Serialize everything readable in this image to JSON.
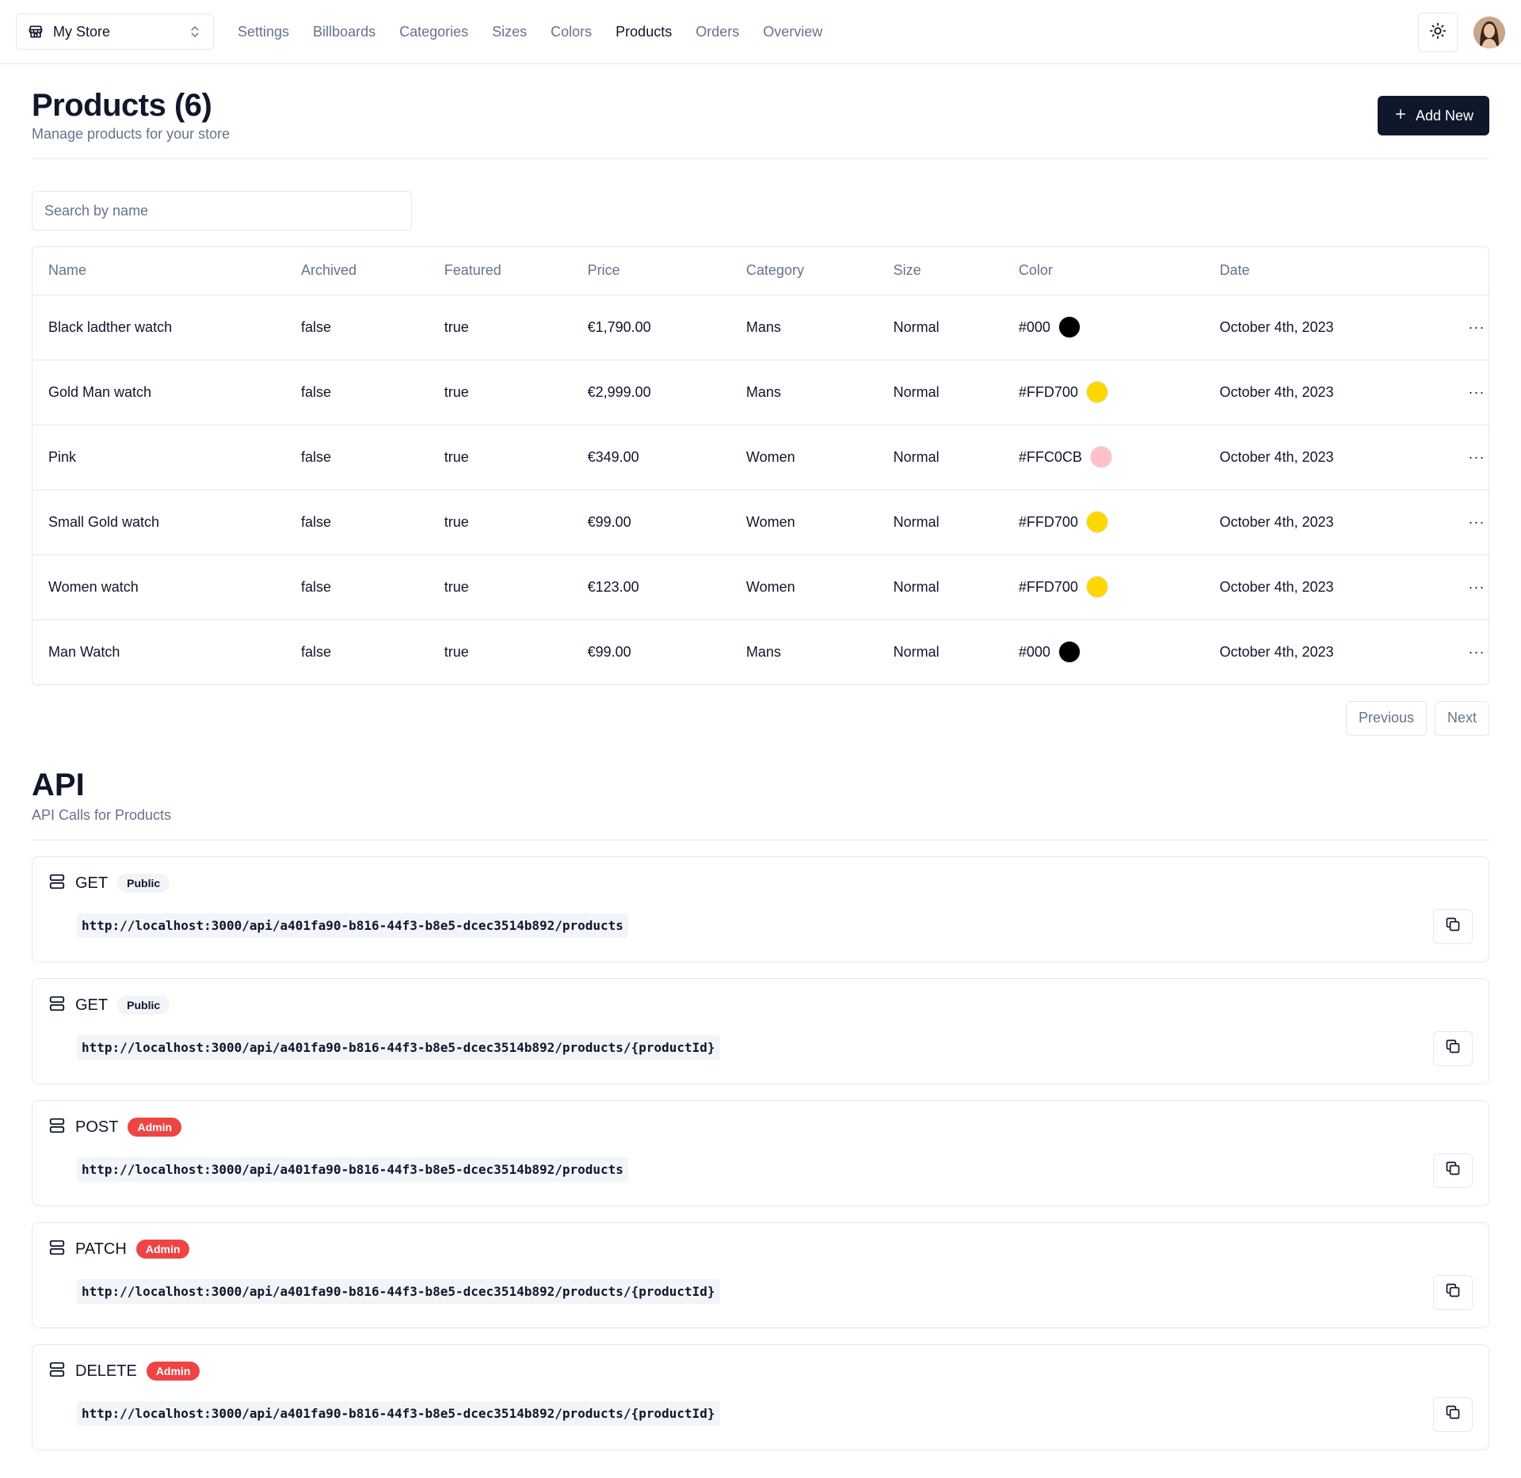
{
  "store": {
    "name": "My Store"
  },
  "nav": [
    {
      "label": "Settings",
      "active": false
    },
    {
      "label": "Billboards",
      "active": false
    },
    {
      "label": "Categories",
      "active": false
    },
    {
      "label": "Sizes",
      "active": false
    },
    {
      "label": "Colors",
      "active": false
    },
    {
      "label": "Products",
      "active": true
    },
    {
      "label": "Orders",
      "active": false
    },
    {
      "label": "Overview",
      "active": false
    }
  ],
  "header": {
    "title": "Products (6)",
    "subtitle": "Manage products for your store",
    "add_label": "Add New"
  },
  "search": {
    "placeholder": "Search by name"
  },
  "table": {
    "columns": [
      "Name",
      "Archived",
      "Featured",
      "Price",
      "Category",
      "Size",
      "Color",
      "Date"
    ],
    "rows": [
      {
        "name": "Black ladther watch",
        "archived": "false",
        "featured": "true",
        "price": "€1,790.00",
        "category": "Mans",
        "size": "Normal",
        "color": "#000",
        "date": "October 4th, 2023",
        "actions": "···"
      },
      {
        "name": "Gold Man watch",
        "archived": "false",
        "featured": "true",
        "price": "€2,999.00",
        "category": "Mans",
        "size": "Normal",
        "color": "#FFD700",
        "date": "October 4th, 2023",
        "actions": "···"
      },
      {
        "name": "Pink",
        "archived": "false",
        "featured": "true",
        "price": "€349.00",
        "category": "Women",
        "size": "Normal",
        "color": "#FFC0CB",
        "date": "October 4th, 2023",
        "actions": "···"
      },
      {
        "name": "Small Gold watch",
        "archived": "false",
        "featured": "true",
        "price": "€99.00",
        "category": "Women",
        "size": "Normal",
        "color": "#FFD700",
        "date": "October 4th, 2023",
        "actions": "···"
      },
      {
        "name": "Women watch",
        "archived": "false",
        "featured": "true",
        "price": "€123.00",
        "category": "Women",
        "size": "Normal",
        "color": "#FFD700",
        "date": "October 4th, 2023",
        "actions": "···"
      },
      {
        "name": "Man Watch",
        "archived": "false",
        "featured": "true",
        "price": "€99.00",
        "category": "Mans",
        "size": "Normal",
        "color": "#000",
        "date": "October 4th, 2023",
        "actions": "···"
      }
    ]
  },
  "pager": {
    "previous": "Previous",
    "next": "Next"
  },
  "api": {
    "title": "API",
    "subtitle": "API Calls for Products",
    "calls": [
      {
        "method": "GET",
        "badge": "Public",
        "variant": "public",
        "url": "http://localhost:3000/api/a401fa90-b816-44f3-b8e5-dcec3514b892/products"
      },
      {
        "method": "GET",
        "badge": "Public",
        "variant": "public",
        "url": "http://localhost:3000/api/a401fa90-b816-44f3-b8e5-dcec3514b892/products/{productId}"
      },
      {
        "method": "POST",
        "badge": "Admin",
        "variant": "admin",
        "url": "http://localhost:3000/api/a401fa90-b816-44f3-b8e5-dcec3514b892/products"
      },
      {
        "method": "PATCH",
        "badge": "Admin",
        "variant": "admin",
        "url": "http://localhost:3000/api/a401fa90-b816-44f3-b8e5-dcec3514b892/products/{productId}"
      },
      {
        "method": "DELETE",
        "badge": "Admin",
        "variant": "admin",
        "url": "http://localhost:3000/api/a401fa90-b816-44f3-b8e5-dcec3514b892/products/{productId}"
      }
    ]
  },
  "colors": {
    "primary": "#0f172a",
    "muted": "#64748b",
    "border": "#e2e8f0",
    "admin": "#ef4444"
  },
  "icons": {
    "store": "store-icon",
    "switch": "chevrons-up-down-icon",
    "theme": "sun-icon",
    "add": "plus-icon",
    "server": "server-icon",
    "copy": "copy-icon",
    "more": "more-horizontal-icon"
  }
}
